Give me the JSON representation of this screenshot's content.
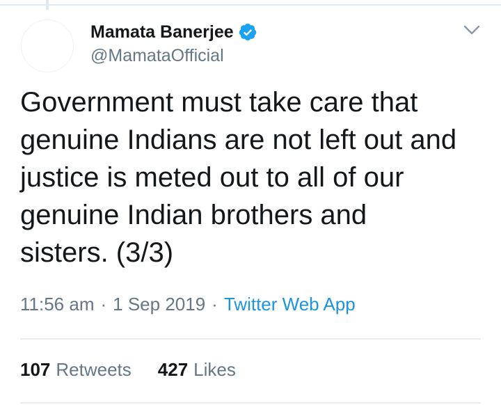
{
  "tweet": {
    "author": {
      "display_name": "Mamata Banerjee",
      "handle": "@MamataOfficial",
      "verified": true,
      "verified_icon": "verified-badge-icon"
    },
    "text": "Government must take care that\ngenuine Indians are not left out and\njustice is meted out to all of our\ngenuine Indian brothers and\nsisters. (3/3)",
    "meta": {
      "time": "11:56 am",
      "separator": "·",
      "date": "1 Sep 2019",
      "source": "Twitter Web App"
    },
    "stats": {
      "retweets_count": "107",
      "retweets_label": "Retweets",
      "likes_count": "427",
      "likes_label": "Likes"
    },
    "menu_icon": "chevron-down-icon"
  },
  "colors": {
    "text_primary": "#14171a",
    "text_secondary": "#657786",
    "link_blue": "#1b95e0",
    "verified_blue": "#1da1f2",
    "divider": "#e6ecf0"
  }
}
